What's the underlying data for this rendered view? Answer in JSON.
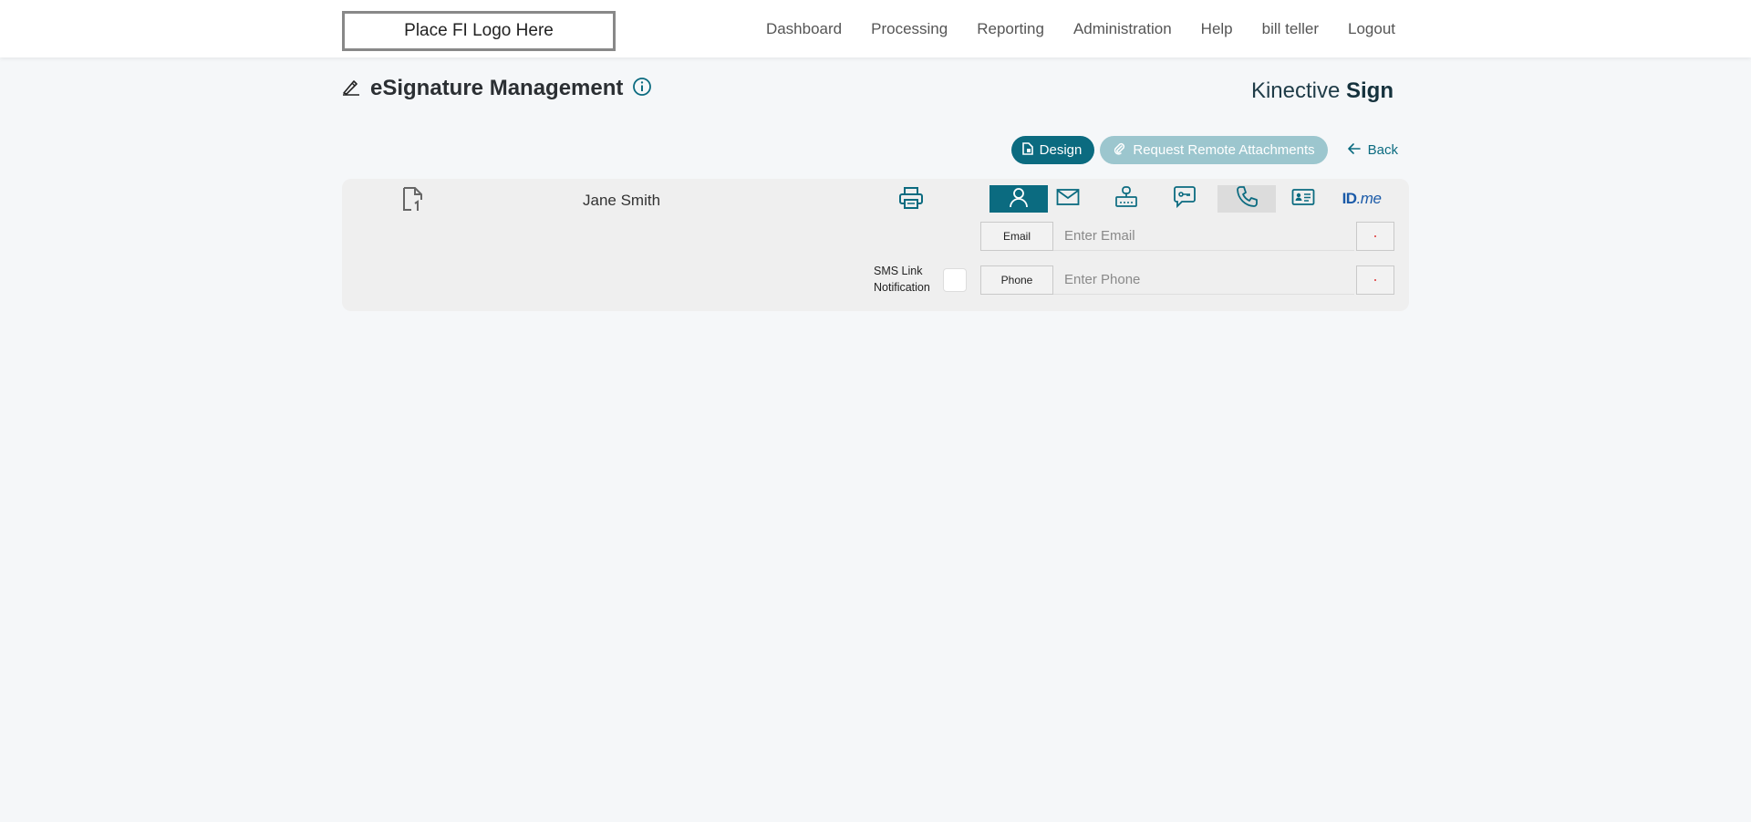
{
  "header": {
    "logo_text": "Place FI Logo Here",
    "nav": [
      "Dashboard",
      "Processing",
      "Reporting",
      "Administration",
      "Help",
      "bill teller",
      "Logout"
    ]
  },
  "page": {
    "title": "eSignature Management",
    "brand_light": "Kinective ",
    "brand_bold": "Sign"
  },
  "actions": {
    "design_label": "Design",
    "remote_label": "Request Remote Attachments",
    "back_label": "Back"
  },
  "signer": {
    "name": "Jane Smith",
    "tabs": [
      "person-icon",
      "mail-icon",
      "router-lock-icon",
      "chat-key-icon",
      "phone-icon",
      "id-card-icon",
      "idme-logo"
    ],
    "idme_text_a": "ID",
    "idme_text_b": ".me",
    "email": {
      "label": "Email",
      "placeholder": "Enter Email"
    },
    "phone": {
      "label": "Phone",
      "placeholder": "Enter Phone"
    },
    "sms_line1": "SMS Link",
    "sms_line2": "Notification"
  },
  "colors": {
    "accent": "#0b6b80",
    "accent_light": "#9cc6ce",
    "background": "#f5f7f9",
    "panel": "#efefef"
  }
}
